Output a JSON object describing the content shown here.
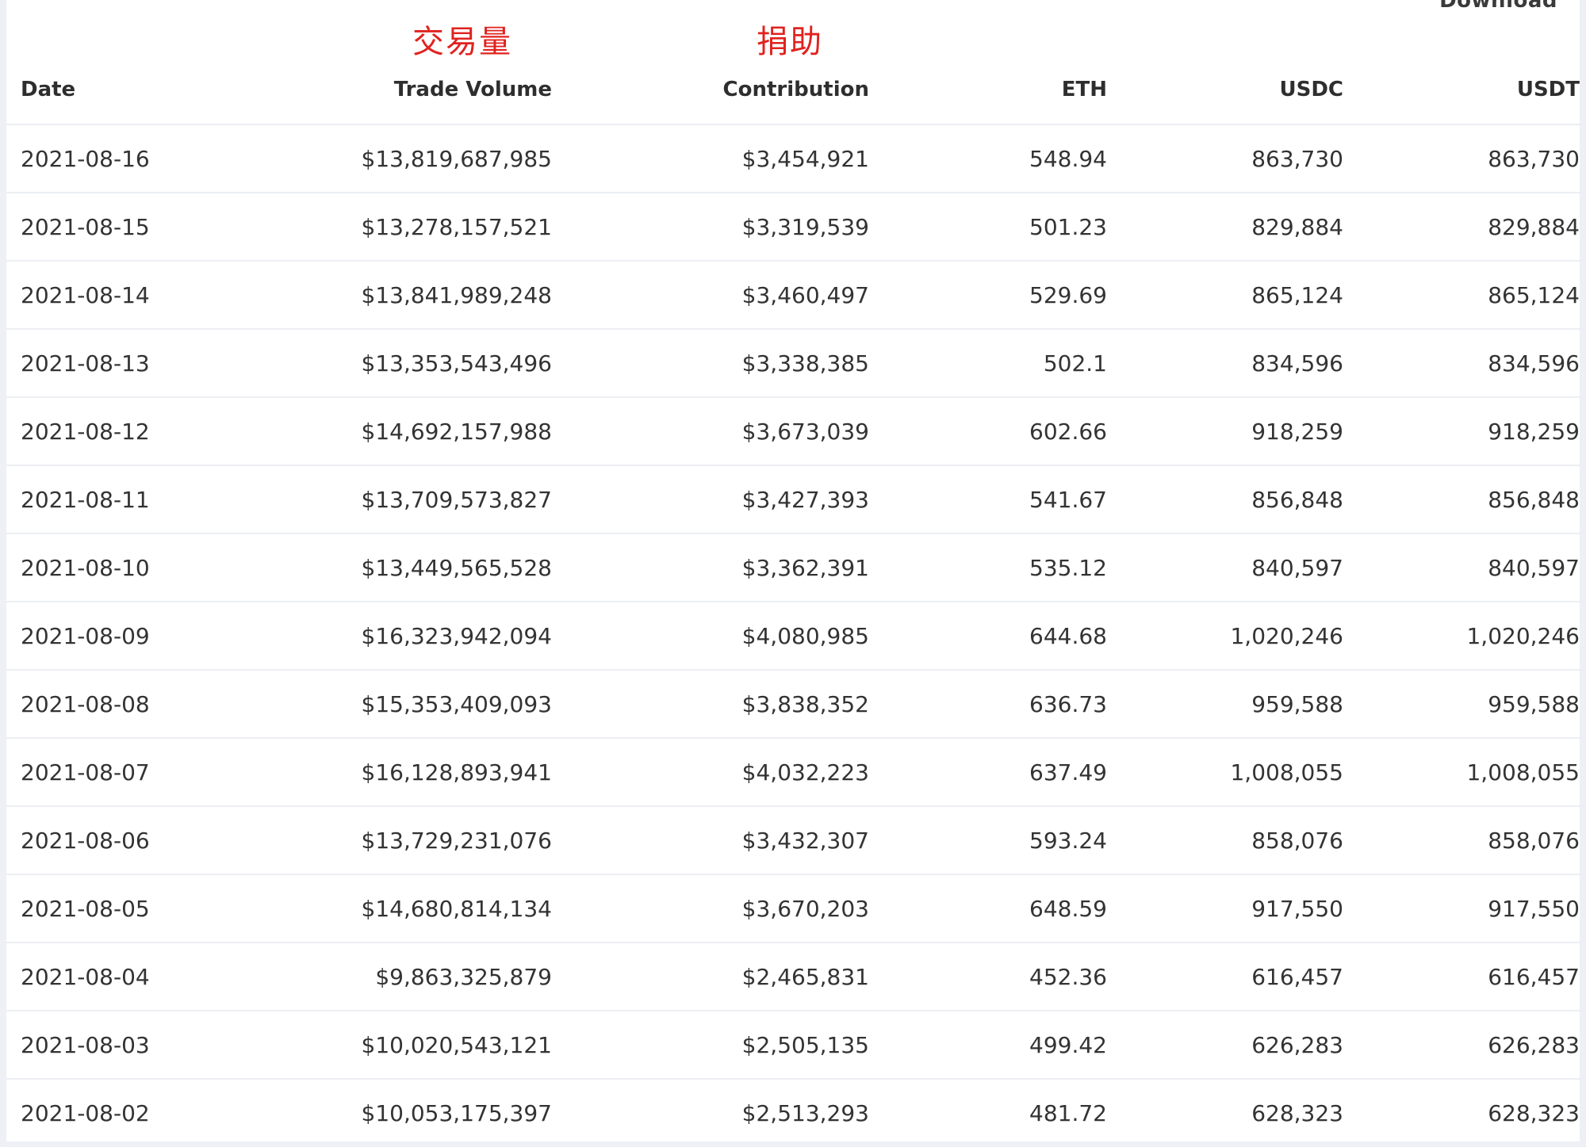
{
  "download_label": "Download",
  "annotations": {
    "trade_volume_zh": "交易量",
    "contribution_zh": "捐助"
  },
  "table": {
    "headers": [
      "Date",
      "Trade Volume",
      "Contribution",
      "ETH",
      "USDC",
      "USDT"
    ],
    "rows": [
      [
        "2021-08-16",
        "$13,819,687,985",
        "$3,454,921",
        "548.94",
        "863,730",
        "863,730"
      ],
      [
        "2021-08-15",
        "$13,278,157,521",
        "$3,319,539",
        "501.23",
        "829,884",
        "829,884"
      ],
      [
        "2021-08-14",
        "$13,841,989,248",
        "$3,460,497",
        "529.69",
        "865,124",
        "865,124"
      ],
      [
        "2021-08-13",
        "$13,353,543,496",
        "$3,338,385",
        "502.1",
        "834,596",
        "834,596"
      ],
      [
        "2021-08-12",
        "$14,692,157,988",
        "$3,673,039",
        "602.66",
        "918,259",
        "918,259"
      ],
      [
        "2021-08-11",
        "$13,709,573,827",
        "$3,427,393",
        "541.67",
        "856,848",
        "856,848"
      ],
      [
        "2021-08-10",
        "$13,449,565,528",
        "$3,362,391",
        "535.12",
        "840,597",
        "840,597"
      ],
      [
        "2021-08-09",
        "$16,323,942,094",
        "$4,080,985",
        "644.68",
        "1,020,246",
        "1,020,246"
      ],
      [
        "2021-08-08",
        "$15,353,409,093",
        "$3,838,352",
        "636.73",
        "959,588",
        "959,588"
      ],
      [
        "2021-08-07",
        "$16,128,893,941",
        "$4,032,223",
        "637.49",
        "1,008,055",
        "1,008,055"
      ],
      [
        "2021-08-06",
        "$13,729,231,076",
        "$3,432,307",
        "593.24",
        "858,076",
        "858,076"
      ],
      [
        "2021-08-05",
        "$14,680,814,134",
        "$3,670,203",
        "648.59",
        "917,550",
        "917,550"
      ],
      [
        "2021-08-04",
        "$9,863,325,879",
        "$2,465,831",
        "452.36",
        "616,457",
        "616,457"
      ],
      [
        "2021-08-03",
        "$10,020,543,121",
        "$2,505,135",
        "499.42",
        "626,283",
        "626,283"
      ],
      [
        "2021-08-02",
        "$10,053,175,397",
        "$2,513,293",
        "481.72",
        "628,323",
        "628,323"
      ]
    ]
  }
}
